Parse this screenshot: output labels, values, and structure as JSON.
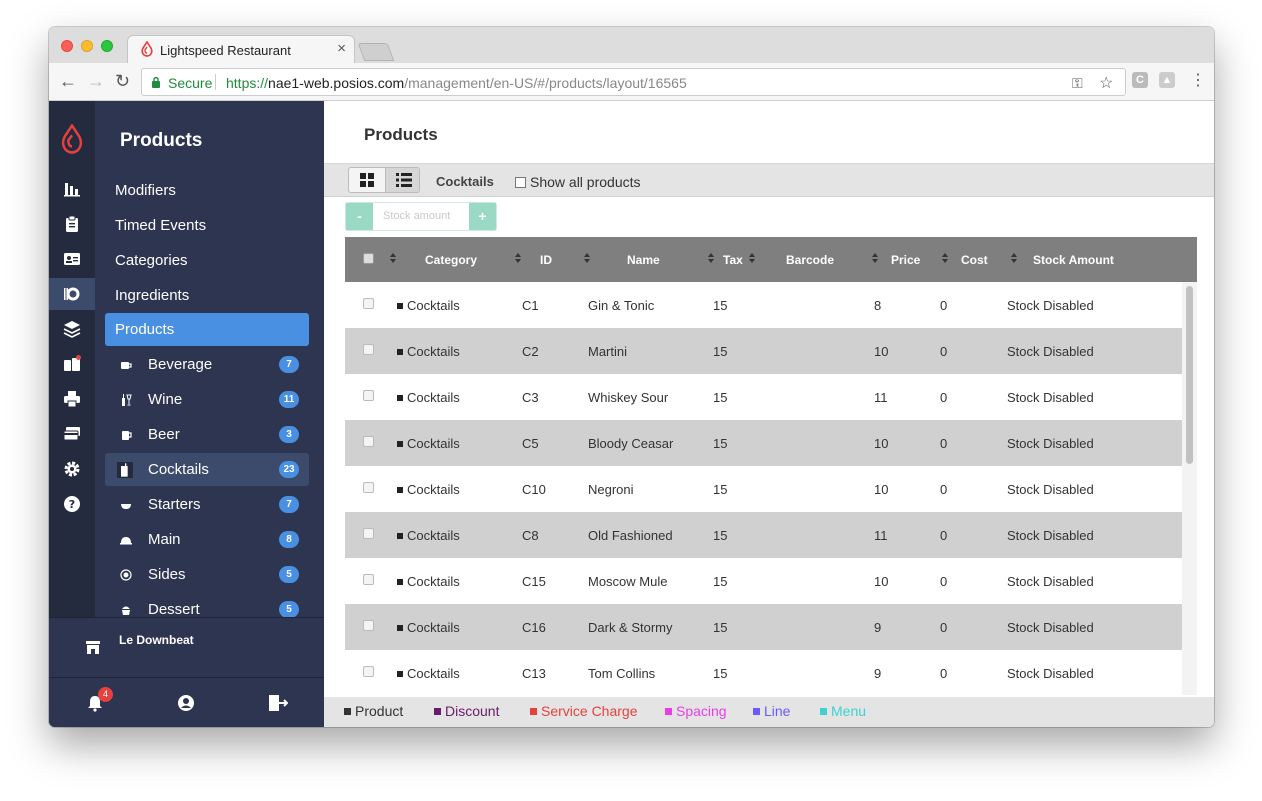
{
  "browser": {
    "tab_title": "Lightspeed Restaurant",
    "tab_close": "×",
    "secure_label": "Secure",
    "url_scheme": "https://",
    "url_host": "nae1-web.posios.com",
    "url_path": "/management/en-US/#/products/layout/16565",
    "nav_back": "←",
    "nav_forward": "→",
    "nav_reload": "↻",
    "key_icon": "⚿",
    "star_icon": "☆",
    "ext1": "C",
    "ext2": "▲",
    "menu": "⋮"
  },
  "sidebar": {
    "title": "Products",
    "links": [
      "Modifiers",
      "Timed Events",
      "Categories",
      "Ingredients"
    ],
    "active_link": "Products",
    "subcategories": [
      {
        "label": "Beverage",
        "count": "7"
      },
      {
        "label": "Wine",
        "count": "11"
      },
      {
        "label": "Beer",
        "count": "3"
      },
      {
        "label": "Cocktails",
        "count": "23"
      },
      {
        "label": "Starters",
        "count": "7"
      },
      {
        "label": "Main",
        "count": "8"
      },
      {
        "label": "Sides",
        "count": "5"
      },
      {
        "label": "Dessert",
        "count": "5"
      }
    ],
    "selected_subcategory": "Cocktails",
    "store_name": "Le Downbeat",
    "notification_count": "4"
  },
  "main": {
    "title": "Products",
    "category_label": "Cocktails",
    "show_all_label": "Show all products",
    "stock": {
      "minus": "-",
      "placeholder": "Stock amount",
      "plus": "+"
    },
    "columns": [
      "Category",
      "ID",
      "Name",
      "Tax",
      "Barcode",
      "Price",
      "Cost",
      "Stock Amount"
    ],
    "rows": [
      {
        "category": "Cocktails",
        "id": "C1",
        "name": "Gin & Tonic",
        "tax": "15",
        "barcode": "",
        "price": "8",
        "cost": "0",
        "stock": "Stock Disabled"
      },
      {
        "category": "Cocktails",
        "id": "C2",
        "name": "Martini",
        "tax": "15",
        "barcode": "",
        "price": "10",
        "cost": "0",
        "stock": "Stock Disabled"
      },
      {
        "category": "Cocktails",
        "id": "C3",
        "name": "Whiskey Sour",
        "tax": "15",
        "barcode": "",
        "price": "11",
        "cost": "0",
        "stock": "Stock Disabled"
      },
      {
        "category": "Cocktails",
        "id": "C5",
        "name": "Bloody Ceasar",
        "tax": "15",
        "barcode": "",
        "price": "10",
        "cost": "0",
        "stock": "Stock Disabled"
      },
      {
        "category": "Cocktails",
        "id": "C10",
        "name": "Negroni",
        "tax": "15",
        "barcode": "",
        "price": "10",
        "cost": "0",
        "stock": "Stock Disabled"
      },
      {
        "category": "Cocktails",
        "id": "C8",
        "name": "Old Fashioned",
        "tax": "15",
        "barcode": "",
        "price": "11",
        "cost": "0",
        "stock": "Stock Disabled"
      },
      {
        "category": "Cocktails",
        "id": "C15",
        "name": "Moscow Mule",
        "tax": "15",
        "barcode": "",
        "price": "10",
        "cost": "0",
        "stock": "Stock Disabled"
      },
      {
        "category": "Cocktails",
        "id": "C16",
        "name": "Dark & Stormy",
        "tax": "15",
        "barcode": "",
        "price": "9",
        "cost": "0",
        "stock": "Stock Disabled"
      },
      {
        "category": "Cocktails",
        "id": "C13",
        "name": "Tom Collins",
        "tax": "15",
        "barcode": "",
        "price": "9",
        "cost": "0",
        "stock": "Stock Disabled"
      }
    ],
    "legend": [
      {
        "label": "Product",
        "color": "#333333"
      },
      {
        "label": "Discount",
        "color": "#6b1a6b"
      },
      {
        "label": "Service Charge",
        "color": "#e8413d"
      },
      {
        "label": "Spacing",
        "color": "#e83ee8"
      },
      {
        "label": "Line",
        "color": "#6b5bff"
      },
      {
        "label": "Menu",
        "color": "#3fd0d0"
      }
    ]
  },
  "colors": {
    "accent": "#4a90e2",
    "rail": "#252b3f",
    "sidebar": "#2d3550"
  }
}
